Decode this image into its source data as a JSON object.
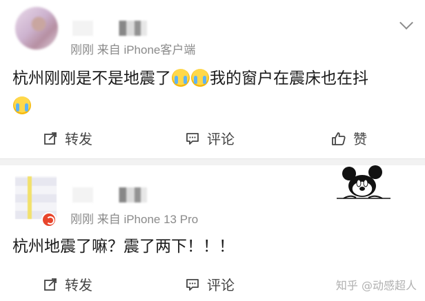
{
  "posts": [
    {
      "meta": "刚刚  来自 iPhone客户端",
      "content_parts": [
        "杭州刚刚是不是地震了",
        "我的窗户在震床也在抖"
      ],
      "actions": {
        "repost": "转发",
        "comment": "评论",
        "like": "赞"
      }
    },
    {
      "meta": "刚刚  来自 iPhone 13 Pro",
      "content": "杭州地震了嘛？震了两下！！！",
      "actions": {
        "repost": "转发",
        "comment": "评论"
      }
    }
  ],
  "watermark": "知乎 @动感超人",
  "icons": {
    "chevron": "chevron-down-icon",
    "repost": "share-icon",
    "comment": "comment-icon",
    "like": "thumbs-up-icon",
    "emoji": "crying-face-emoji",
    "sticker": "mickey-mouse-sticker"
  },
  "colors": {
    "meta_text": "#8a8a8a",
    "divider": "#f2f2f2",
    "badge": "#e8452c"
  }
}
